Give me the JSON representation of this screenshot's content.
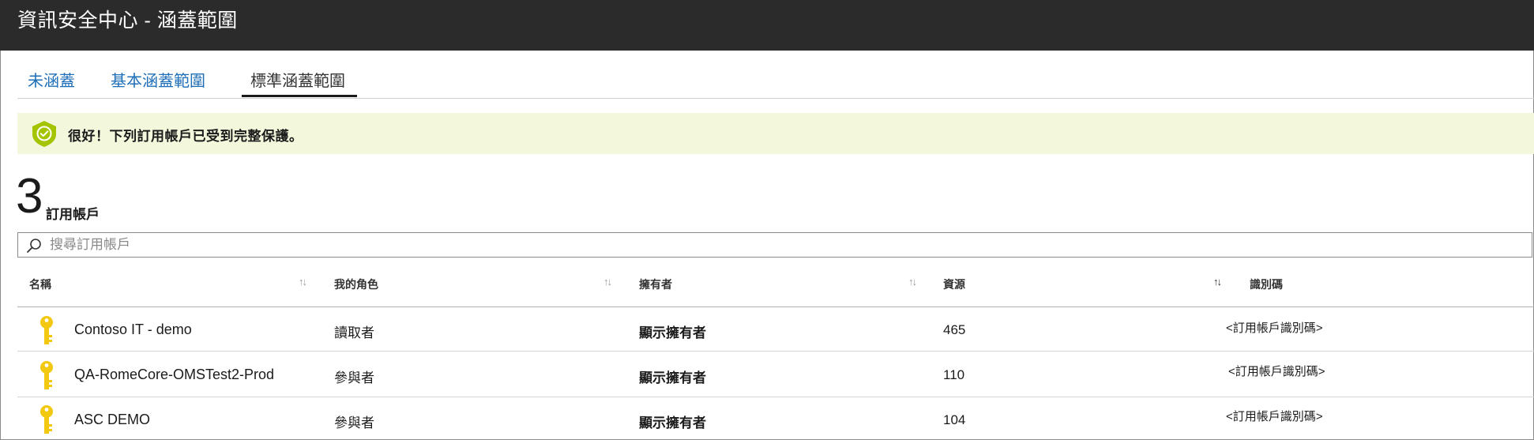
{
  "window": {
    "title": "資訊安全中心 - 涵蓋範圍"
  },
  "tabs": [
    {
      "label": "未涵蓋",
      "active": false
    },
    {
      "label": "基本涵蓋範圍",
      "active": false
    },
    {
      "label": "標準涵蓋範圍",
      "active": true
    }
  ],
  "banner": {
    "icon": "shield-check-icon",
    "text": "很好！下列訂用帳戶已受到完整保護。"
  },
  "summary": {
    "count": "3",
    "label": "訂用帳戶"
  },
  "search": {
    "placeholder": "搜尋訂用帳戶",
    "value": ""
  },
  "table": {
    "columns": [
      "名稱",
      "我的角色",
      "擁有者",
      "資源",
      "識別碼"
    ],
    "rows": [
      {
        "name": "Contoso IT - demo",
        "role": "讀取者",
        "owner": "顯示擁有者",
        "resources": "465",
        "id": "<訂用帳戶識別碼>"
      },
      {
        "name": "QA-RomeCore-OMSTest2-Prod",
        "role": "參與者",
        "owner": "顯示擁有者",
        "resources": "110",
        "id": "<訂用帳戶識別碼>"
      },
      {
        "name": "ASC DEMO",
        "role": "參與者",
        "owner": "顯示擁有者",
        "resources": "104",
        "id": "<訂用帳戶識別碼>"
      }
    ]
  },
  "colors": {
    "titlebar": "#2b2b2b",
    "link": "#1f6fb8",
    "banner_bg": "#f3f7dc",
    "shield": "#a4c400",
    "key": "#f2c811"
  }
}
